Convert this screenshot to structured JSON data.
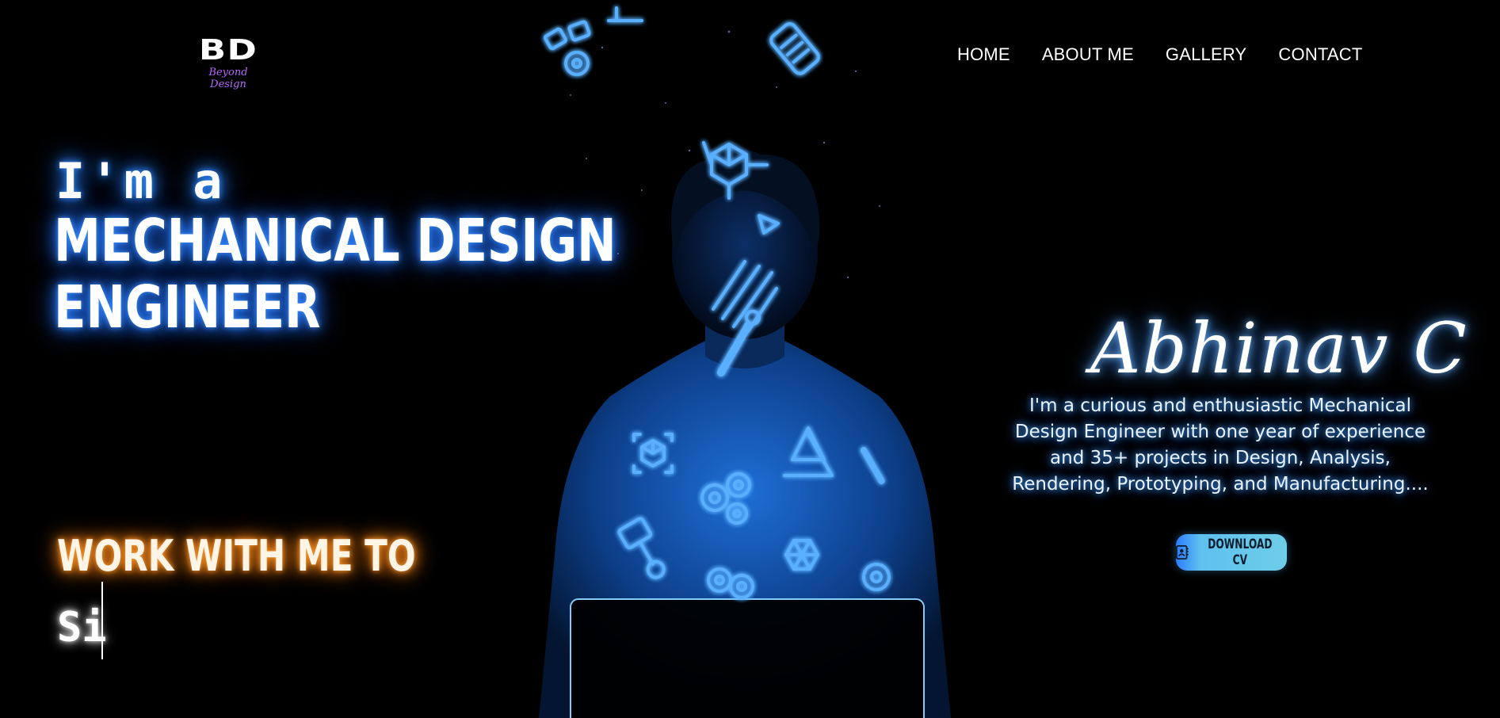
{
  "header": {
    "logo_text": "BD",
    "logo_tagline": "Beyond Design",
    "nav": [
      "HOME",
      "ABOUT ME",
      "GALLERY",
      "CONTACT"
    ]
  },
  "hero": {
    "intro": "I'm a",
    "role_line1": "MECHANICAL DESIGN",
    "role_line2": "ENGINEER",
    "cta_heading": "WORK WITH ME TO",
    "typed_text": "Si"
  },
  "about": {
    "name": "Abhinav C",
    "bio": "I'm a curious and enthusiastic Mechanical Design Engineer with one year of experience and 35+ projects in Design, Analysis, Rendering, Prototyping, and Manufacturing....",
    "download_button": "DOWNLOAD CV"
  },
  "colors": {
    "background": "#000000",
    "neon_blue": "#2f8bff",
    "neon_orange": "#ff8a1c",
    "button": "#6ecde8",
    "logo_accent": "#b768ff"
  }
}
